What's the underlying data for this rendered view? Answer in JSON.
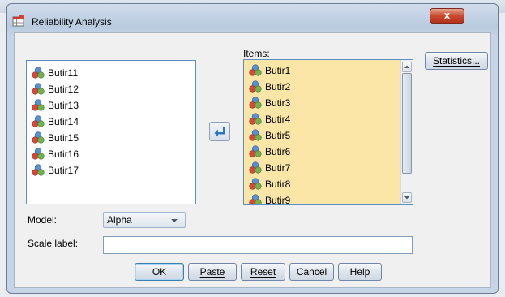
{
  "window": {
    "title": "Reliability Analysis",
    "close_label": "x"
  },
  "available_variables": [
    "Butir11",
    "Butir12",
    "Butir13",
    "Butir14",
    "Butir15",
    "Butir16",
    "Butir17"
  ],
  "items": {
    "label": "Items:",
    "variables": [
      "Butir1",
      "Butir2",
      "Butir3",
      "Butir4",
      "Butir5",
      "Butir6",
      "Butir7",
      "Butir8",
      "Butir9"
    ]
  },
  "buttons": {
    "statistics": "Statistics...",
    "ok": "OK",
    "paste": "Paste",
    "reset": "Reset",
    "cancel": "Cancel",
    "help": "Help"
  },
  "model": {
    "label": "Model:",
    "value": "Alpha"
  },
  "scale_label": {
    "label": "Scale label:",
    "value": ""
  },
  "colors": {
    "items_background": "#fbe6a8",
    "list_border": "#5b8fc7",
    "move_arrow": "#2d75c0"
  }
}
